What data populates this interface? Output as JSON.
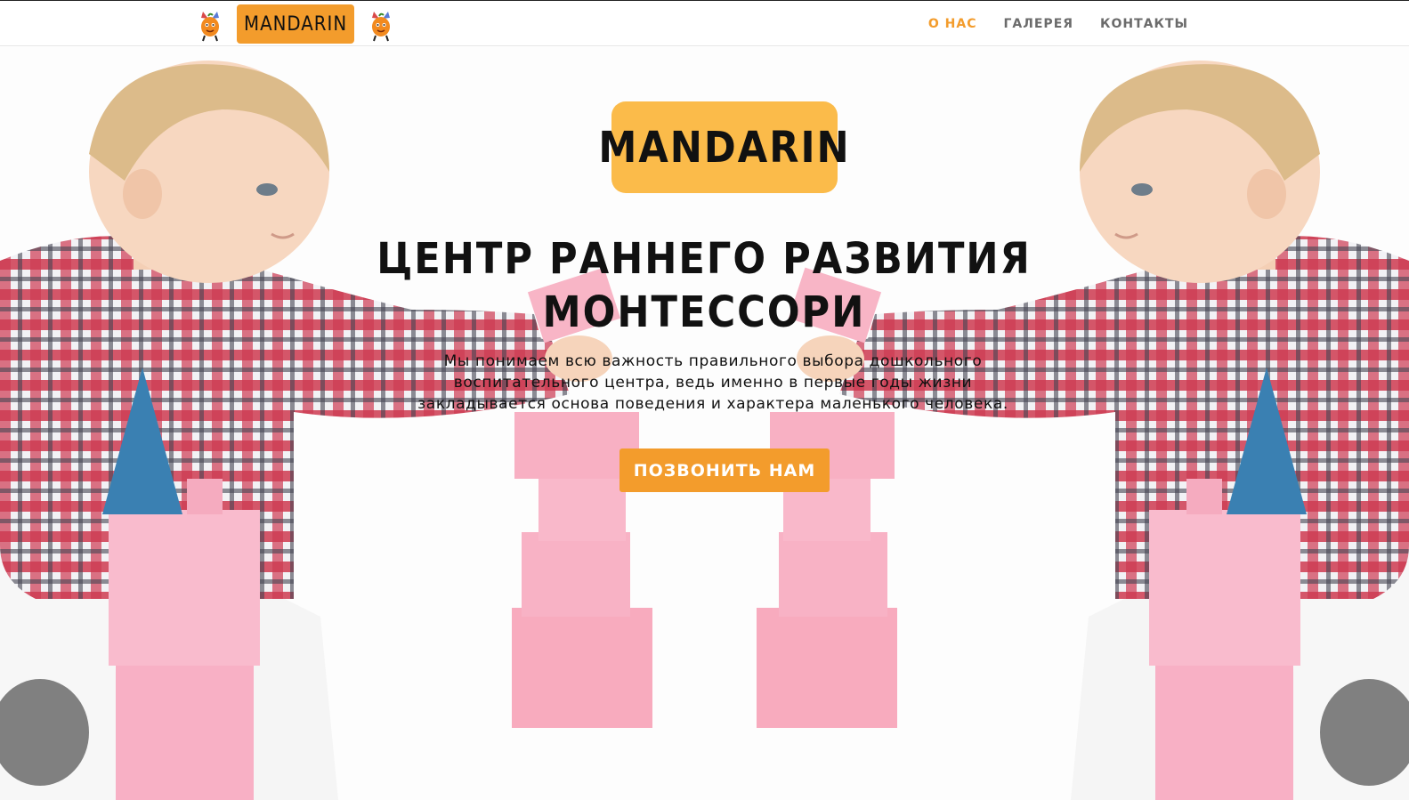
{
  "header": {
    "logo_text": "MANDARIN",
    "nav": [
      {
        "label": "О НАС",
        "active": true
      },
      {
        "label": "ГАЛЕРЕЯ",
        "active": false
      },
      {
        "label": "КОНТАКТЫ",
        "active": false
      }
    ]
  },
  "hero": {
    "logo_text": "MANDARIN",
    "title_line1": "ЦЕНТР РАННЕГО РАЗВИТИЯ",
    "title_line2": "МОНТЕССОРИ",
    "text": "Мы понимаем всю важность правильного выбора дошкольного воспитательного центра, ведь именно в первые годы жизни закладывается основа поведения и характера маленького человека.",
    "cta_label": "ПОЗВОНИТЬ НАМ"
  },
  "colors": {
    "accent": "#f39c2c",
    "hero_logo_bg": "#fbbb4a",
    "nav_text": "#6b6b6b",
    "block_pink": "#f7a6bd",
    "cone_blue": "#1f6fa8"
  },
  "icons": [
    "mandarin-mascot-icon",
    "mandarin-mascot-icon"
  ]
}
